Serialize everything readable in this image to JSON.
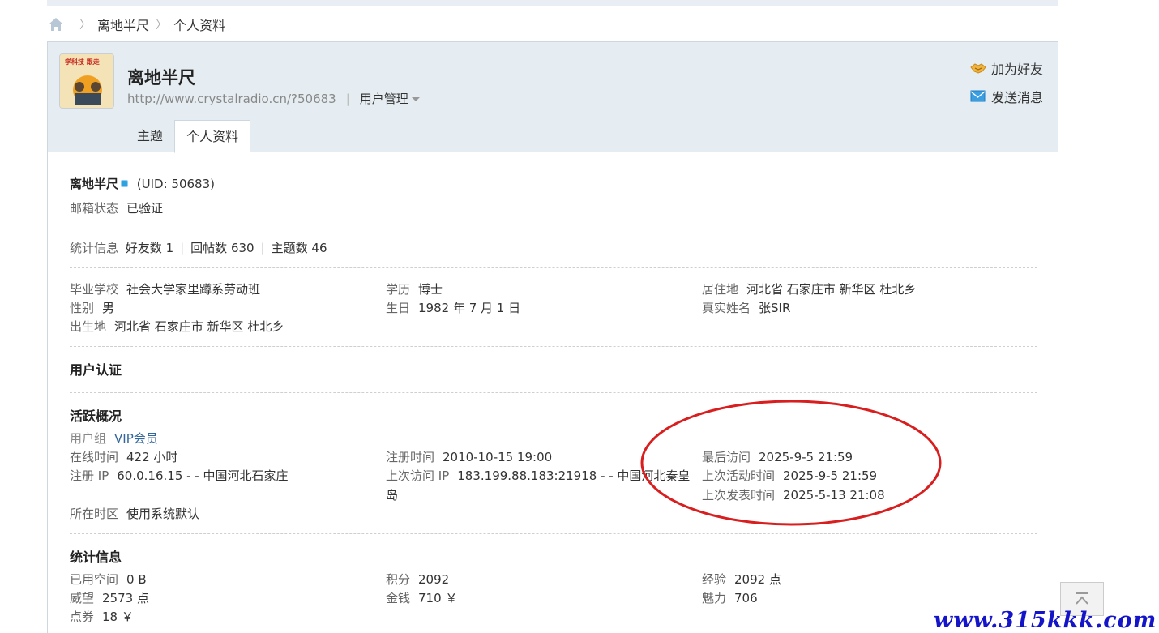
{
  "breadcrumb": {
    "items": [
      "离地半尺",
      "个人资料"
    ]
  },
  "profile": {
    "name": "离地半尺",
    "url": "http://www.crystalradio.cn/?50683",
    "manage_label": "用户管理"
  },
  "actions": {
    "add_friend": "加为好友",
    "send_message": "发送消息"
  },
  "tabs": [
    {
      "label": "主题"
    },
    {
      "label": "个人资料"
    }
  ],
  "basic": {
    "name": "离地半尺",
    "uid": "(UID: 50683)",
    "email_label": "邮箱状态",
    "email_value": "已验证",
    "stats_label": "统计信息",
    "friends": "好友数 1",
    "replies": "回帖数 630",
    "topics": "主题数 46"
  },
  "info": {
    "school_label": "毕业学校",
    "school": "社会大学家里蹲系劳动班",
    "edu_label": "学历",
    "edu": "博士",
    "residence_label": "居住地",
    "residence": "河北省 石家庄市 新华区 杜北乡",
    "gender_label": "性别",
    "gender": "男",
    "birthday_label": "生日",
    "birthday": "1982 年 7 月 1 日",
    "realname_label": "真实姓名",
    "realname": "张SIR",
    "birthplace_label": "出生地",
    "birthplace": "河北省 石家庄市 新华区 杜北乡"
  },
  "cert": {
    "title": "用户认证"
  },
  "activity": {
    "title": "活跃概况",
    "group_label": "用户组",
    "group": "VIP会员",
    "online_label": "在线时间",
    "online": "422 小时",
    "reg_time_label": "注册时间",
    "reg_time": "2010-10-15 19:00",
    "last_visit_label": "最后访问",
    "last_visit": "2025-9-5 21:59",
    "reg_ip_label": "注册 IP",
    "reg_ip": "60.0.16.15 - - 中国河北石家庄",
    "last_ip_label": "上次访问 IP",
    "last_ip": "183.199.88.183:21918 - - 中国河北秦皇",
    "last_ip_cont": "岛",
    "last_active_label": "上次活动时间",
    "last_active": "2025-9-5 21:59",
    "last_post_label": "上次发表时间",
    "last_post": "2025-5-13 21:08",
    "tz_label": "所在时区",
    "tz": "使用系统默认"
  },
  "stats": {
    "title": "统计信息",
    "space_label": "已用空间",
    "space": "0 B",
    "points_label": "积分",
    "points": "2092",
    "exp_label": "经验",
    "exp": "2092 点",
    "prestige_label": "威望",
    "prestige": "2573 点",
    "money_label": "金钱",
    "money": "710 ￥",
    "charm_label": "魅力",
    "charm": "706",
    "coupon_label": "点券",
    "coupon": "18 ￥"
  },
  "watermark": "www.315kkk.com",
  "colors": {
    "header_bg": "#e5edf2",
    "link": "#336699",
    "annotation": "#d81e1e",
    "watermark": "#1414c8"
  }
}
